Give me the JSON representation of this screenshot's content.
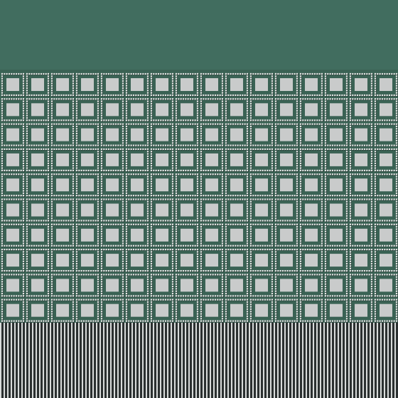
{
  "pattern": {
    "top_band_color": "#416d5f",
    "tile_field_color": "#3a6254",
    "tile_fill_color": "#c9cbcb",
    "dot_color": "#e4e6e5",
    "dot_shadow_color": "#1f2f2a",
    "stripe_light_color": "#d9dcdb",
    "stripe_dark_color": "#2b3030",
    "tile_columns": 16,
    "tile_rows": 10
  }
}
